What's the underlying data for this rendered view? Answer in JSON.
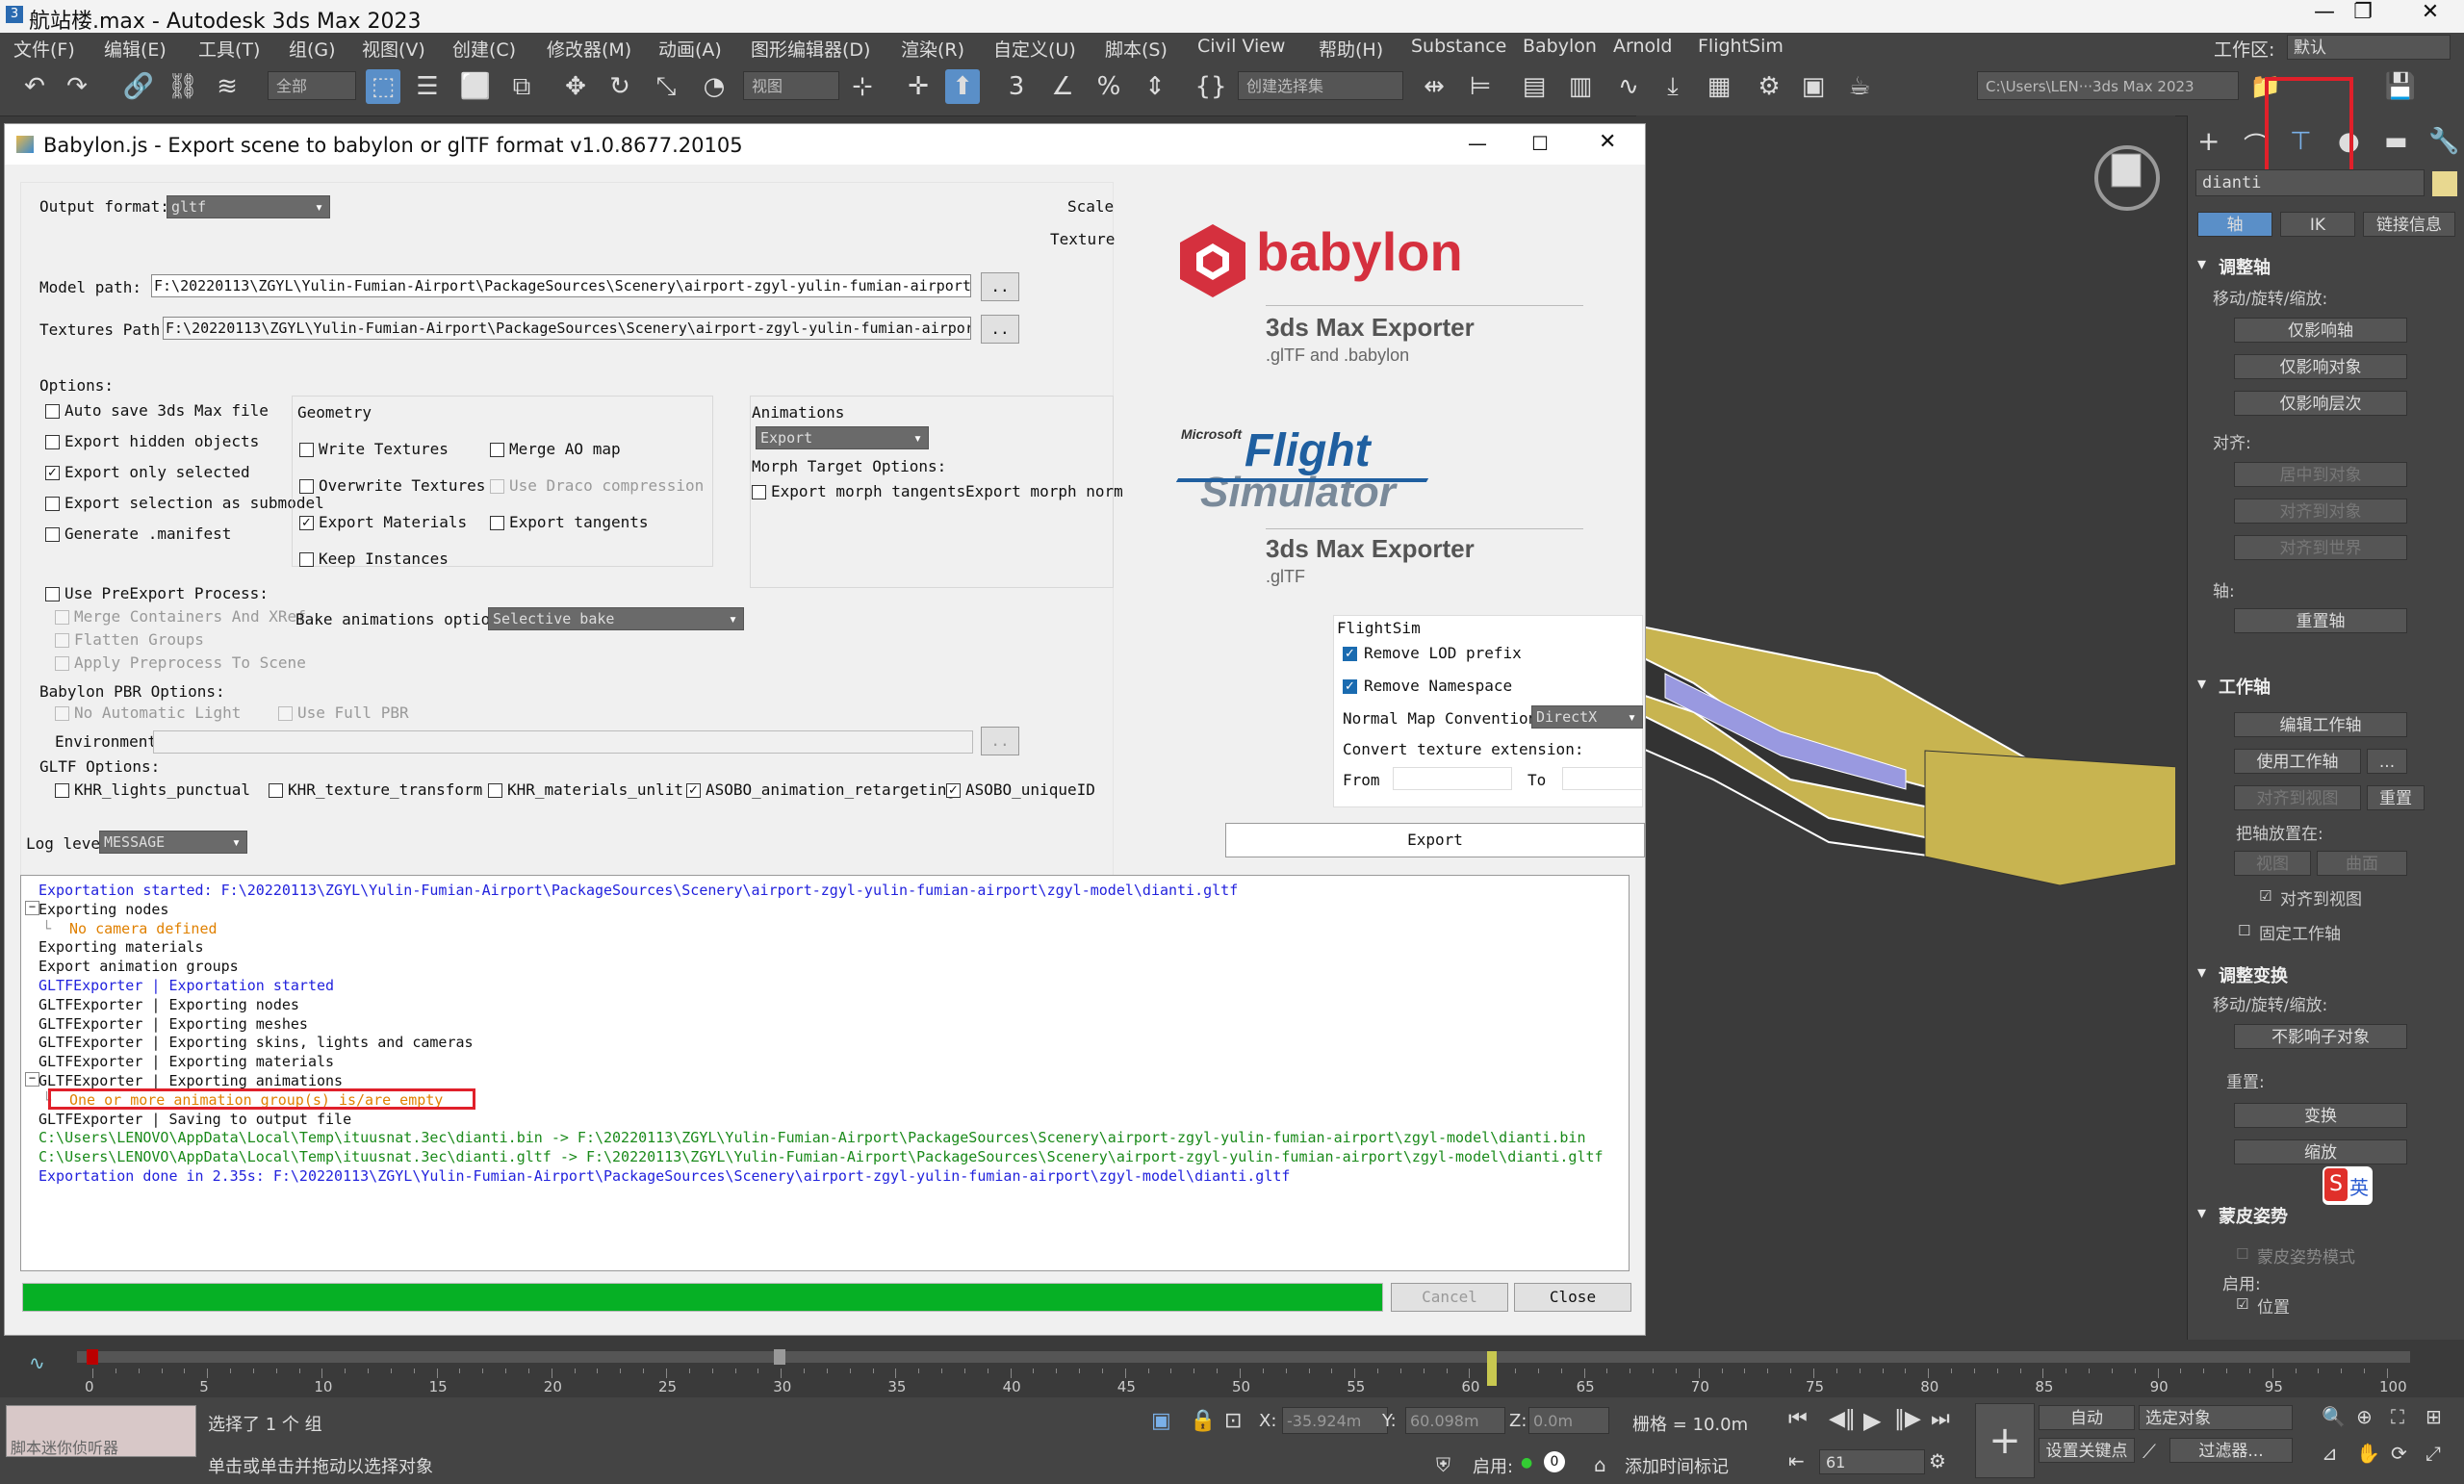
{
  "app": {
    "title": "航站楼.max - Autodesk 3ds Max 2023",
    "workspace_label": "工作区:",
    "workspace_value": "默认"
  },
  "menu": [
    "文件(F)",
    "编辑(E)",
    "工具(T)",
    "组(G)",
    "视图(V)",
    "创建(C)",
    "修改器(M)",
    "动画(A)",
    "图形编辑器(D)",
    "渲染(R)",
    "自定义(U)",
    "脚本(S)",
    "Civil View",
    "帮助(H)",
    "Substance",
    "Babylon",
    "Arnold",
    "FlightSim"
  ],
  "toolbar": {
    "filter_value": "全部",
    "view_value": "视图",
    "selection_set": "创建选择集",
    "path_value": "C:\\Users\\LEN···3ds Max 2023"
  },
  "dialog": {
    "title": "Babylon.js - Export scene to babylon or glTF format v1.0.8677.20105",
    "output_format_label": "Output format:",
    "output_format_value": "gltf",
    "scale_label": "Scale",
    "texture_label": "Texture",
    "model_path_label": "Model path:",
    "model_path_value": "F:\\20220113\\ZGYL\\Yulin-Fumian-Airport\\PackageSources\\Scenery\\airport-zgyl-yulin-fumian-airport",
    "textures_path_label": "Textures Path:",
    "textures_path_value": "F:\\20220113\\ZGYL\\Yulin-Fumian-Airport\\PackageSources\\Scenery\\airport-zgyl-yulin-fumian-airport",
    "browse_label": "..",
    "options_label": "Options:",
    "options": [
      {
        "label": "Auto save 3ds Max file",
        "checked": false
      },
      {
        "label": "Export hidden objects",
        "checked": false
      },
      {
        "label": "Export only selected",
        "checked": true
      },
      {
        "label": "Export selection as submodel",
        "checked": false
      },
      {
        "label": "Generate .manifest",
        "checked": false
      }
    ],
    "geometry_label": "Geometry",
    "geometry": [
      {
        "label": "Write Textures",
        "checked": false
      },
      {
        "label": "Merge AO map",
        "checked": false
      },
      {
        "label": "Overwrite Textures",
        "checked": false
      },
      {
        "label": "Use Draco compression",
        "checked": false,
        "disabled": true
      },
      {
        "label": "Export Materials",
        "checked": true
      },
      {
        "label": "Export tangents",
        "checked": false
      },
      {
        "label": "Keep Instances",
        "checked": false
      }
    ],
    "animations_label": "Animations",
    "animations_value": "Export",
    "morph_label": "Morph Target Options:",
    "morph_tangents_label": "Export morph tangents",
    "morph_normals_label": "Export morph norm",
    "preexport_label": "Use PreExport Process:",
    "merge_containers_label": "Merge Containers And XRef",
    "flatten_groups_label": "Flatten Groups",
    "apply_preprocess_label": "Apply Preprocess To Scene",
    "bake_label": "Bake animations options:",
    "bake_value": "Selective bake",
    "pbr_label": "Babylon PBR Options:",
    "no_auto_light_label": "No Automatic Light",
    "full_pbr_label": "Use Full PBR",
    "environment_label": "Environment",
    "gltf_options_label": "GLTF Options:",
    "gltf_options": [
      {
        "label": "KHR_lights_punctual",
        "checked": false
      },
      {
        "label": "KHR_texture_transform",
        "checked": false
      },
      {
        "label": "KHR_materials_unlit",
        "checked": false
      },
      {
        "label": "ASOBO_animation_retargeting",
        "checked": true
      },
      {
        "label": "ASOBO_uniqueID",
        "checked": true
      }
    ],
    "log_level_label": "Log level:",
    "log_level_value": "MESSAGE",
    "babylon_logo": "babylon",
    "babylon_sub1": "3ds Max Exporter",
    "babylon_sub2": ".glTF and .babylon",
    "msfs_microsoft": "Microsoft",
    "msfs_flight": "Flight",
    "msfs_simulator": "Simulator",
    "msfs_sub1": "3ds Max Exporter",
    "msfs_sub2": ".glTF",
    "flightsim_label": "FlightSim",
    "remove_lod_label": "Remove LOD prefix",
    "remove_ns_label": "Remove Namespace",
    "normal_map_label": "Normal Map Convention",
    "normal_map_value": "DirectX",
    "convert_ext_label": "Convert texture extension:",
    "from_label": "From",
    "to_label": "To",
    "export_button": "Export",
    "cancel_button": "Cancel",
    "close_button": "Close",
    "progress": 1.0
  },
  "log": [
    {
      "text": "Exportation started: F:\\20220113\\ZGYL\\Yulin-Fumian-Airport\\PackageSources\\Scenery\\airport-zgyl-yulin-fumian-airport\\zgyl-model\\dianti.gltf",
      "color": "blue",
      "indent": 0
    },
    {
      "text": "Exporting nodes",
      "color": "black",
      "indent": 0,
      "tree": "minus"
    },
    {
      "text": "No camera defined",
      "color": "orange",
      "indent": 1
    },
    {
      "text": "Exporting materials",
      "color": "black",
      "indent": 0
    },
    {
      "text": "Export animation groups",
      "color": "black",
      "indent": 0
    },
    {
      "text": "GLTFExporter | Exportation started",
      "color": "blue",
      "indent": 0
    },
    {
      "text": "GLTFExporter | Exporting nodes",
      "color": "black",
      "indent": 0
    },
    {
      "text": "GLTFExporter | Exporting meshes",
      "color": "black",
      "indent": 0
    },
    {
      "text": "GLTFExporter | Exporting skins, lights and cameras",
      "color": "black",
      "indent": 0
    },
    {
      "text": "GLTFExporter | Exporting materials",
      "color": "black",
      "indent": 0
    },
    {
      "text": "GLTFExporter | Exporting animations",
      "color": "black",
      "indent": 0,
      "tree": "minus"
    },
    {
      "text": "One or more animation group(s) is/are empty",
      "color": "orange",
      "indent": 1,
      "highlight": true
    },
    {
      "text": "GLTFExporter | Saving to output file",
      "color": "black",
      "indent": 0
    },
    {
      "text": "C:\\Users\\LENOVO\\AppData\\Local\\Temp\\ituusnat.3ec\\dianti.bin -> F:\\20220113\\ZGYL\\Yulin-Fumian-Airport\\PackageSources\\Scenery\\airport-zgyl-yulin-fumian-airport\\zgyl-model\\dianti.bin",
      "color": "green",
      "indent": 0
    },
    {
      "text": "C:\\Users\\LENOVO\\AppData\\Local\\Temp\\ituusnat.3ec\\dianti.gltf -> F:\\20220113\\ZGYL\\Yulin-Fumian-Airport\\PackageSources\\Scenery\\airport-zgyl-yulin-fumian-airport\\zgyl-model\\dianti.gltf",
      "color": "green",
      "indent": 0
    },
    {
      "text": "Exportation done in 2.35s: F:\\20220113\\ZGYL\\Yulin-Fumian-Airport\\PackageSources\\Scenery\\airport-zgyl-yulin-fumian-airport\\zgyl-model\\dianti.gltf",
      "color": "blue",
      "indent": 0
    }
  ],
  "right_panel": {
    "object_name": "dianti",
    "tabs": [
      "轴",
      "IK",
      "链接信息"
    ],
    "sections": {
      "adjust_pivot": "调整轴",
      "move_rotate_scale": "移动/旋转/缩放:",
      "affect_pivot": "仅影响轴",
      "affect_object": "仅影响对象",
      "affect_hierarchy": "仅影响层次",
      "align": "对齐:",
      "center_to_object": "居中到对象",
      "align_to_object": "对齐到对象",
      "align_to_world": "对齐到世界",
      "pivot": "轴:",
      "reset_pivot": "重置轴",
      "working_pivot": "工作轴",
      "edit_working_pivot": "编辑工作轴",
      "use_working_pivot": "使用工作轴",
      "align_to_view": "对齐到视图",
      "reset": "重置",
      "place_pivot_to": "把轴放置在:",
      "view": "视图",
      "surface": "曲面",
      "align_to_view_cb": "对齐到视图",
      "pin_working_pivot": "固定工作轴",
      "adjust_transform": "调整变换",
      "move_rotate_scale2": "移动/旋转/缩放:",
      "dont_affect_children": "不影响子对象",
      "reset2": "重置:",
      "transform": "变换",
      "scale": "缩放",
      "skin_pose": "蒙皮姿势",
      "skin_pose_mode": "蒙皮姿势模式",
      "enable": "启用:",
      "position": "位置"
    }
  },
  "timeline": {
    "frame_display": "61 / 100",
    "ticks": [
      0,
      5,
      10,
      15,
      20,
      25,
      30,
      35,
      40,
      45,
      50,
      55,
      60,
      65,
      70,
      75,
      80,
      85,
      90,
      95,
      100
    ],
    "current_frame": 61
  },
  "status": {
    "script_listener": "脚本迷你侦听器",
    "selection_text": "选择了 1 个 组",
    "hint_text": "单击或单击并拖动以选择对象",
    "x_label": "X:",
    "x_value": "-35.924m",
    "y_label": "Y:",
    "y_value": "60.098m",
    "z_label": "Z:",
    "z_value": "0.0m",
    "grid_label": "栅格 = 10.0m",
    "enable_label": "启用:",
    "add_time_tag": "添加时间标记",
    "auto_key": "自动",
    "selected_obj": "选定对象",
    "set_key": "设置关键点",
    "filters": "过滤器...",
    "frame_value": "61",
    "ime_label": "英"
  },
  "colors": {
    "progress": "#06b025",
    "highlight_box": "#e0202a",
    "babylon_red": "#d5303e",
    "model_yellow": "#c8b450"
  }
}
